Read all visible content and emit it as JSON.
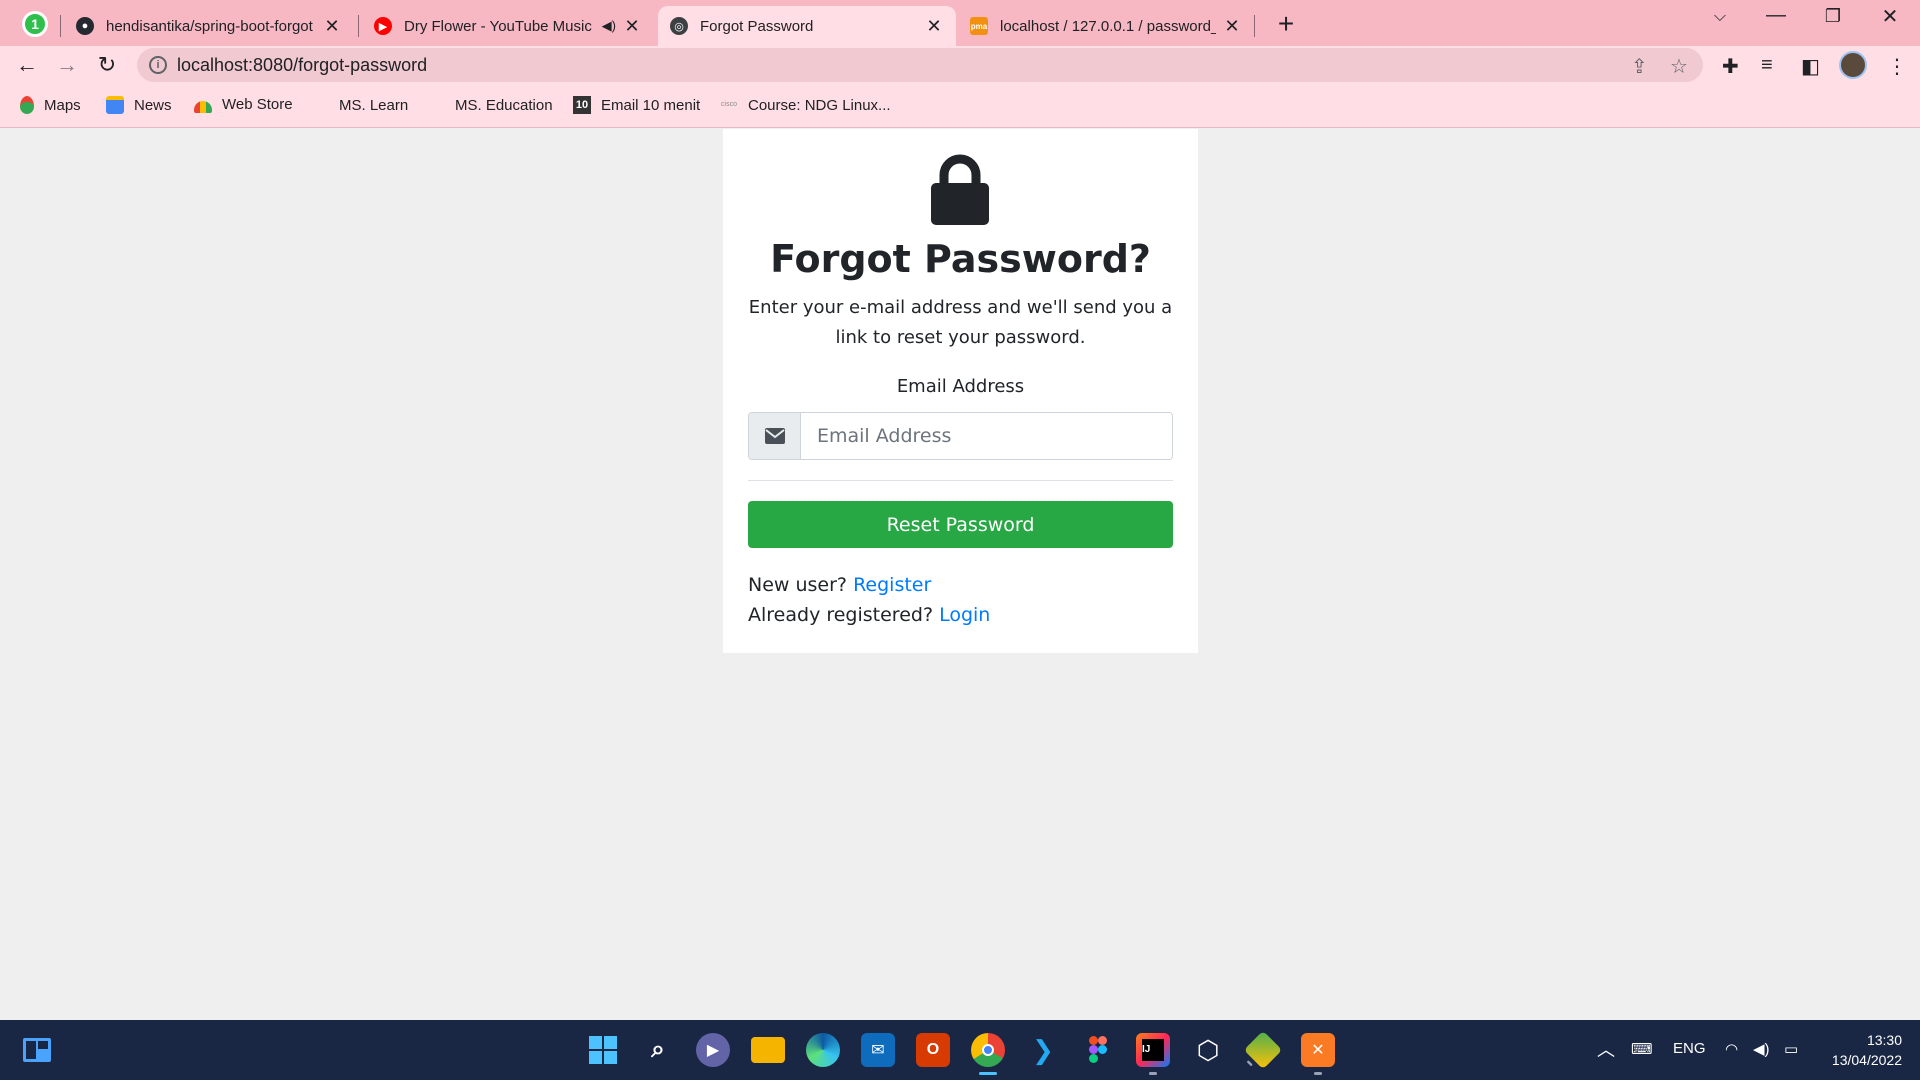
{
  "browser": {
    "tabs": [
      {
        "title": "hendisantika/spring-boot-forgot",
        "favicon": "github-icon"
      },
      {
        "title": "Dry Flower - YouTube Music",
        "favicon": "youtube-music-icon",
        "audio": "speaker-icon"
      },
      {
        "title": "Forgot Password",
        "favicon": "globe-icon",
        "active": true
      },
      {
        "title": "localhost / 127.0.0.1 / password_",
        "favicon": "phpmyadmin-icon"
      }
    ],
    "pinned_badge": "1",
    "url": "localhost:8080/forgot-password",
    "info_glyph": "i"
  },
  "bookmarks": [
    {
      "label": "Maps",
      "icon": "maps-pin-icon"
    },
    {
      "label": "News",
      "icon": "google-news-icon"
    },
    {
      "label": "Web Store",
      "icon": "web-store-icon"
    },
    {
      "label": "MS. Learn",
      "icon": "microsoft-icon"
    },
    {
      "label": "MS. Education",
      "icon": "microsoft-icon"
    },
    {
      "label": "Email 10 menit",
      "icon": "ten-icon",
      "icon_text": "10"
    },
    {
      "label": "Course: NDG Linux...",
      "icon": "cisco-icon",
      "icon_text": "cisco"
    }
  ],
  "page": {
    "title": "Forgot Password?",
    "description": "Enter your e-mail address and we'll send you a link to reset your password.",
    "email_label": "Email Address",
    "email_placeholder": "Email Address",
    "email_value": "",
    "submit_label": "Reset Password",
    "new_user_text": "New user?",
    "register_link": "Register",
    "registered_text": "Already registered?",
    "login_link": "Login"
  },
  "taskbar": {
    "apps": [
      "start-icon",
      "search-icon",
      "teams-chat-icon",
      "file-explorer-icon",
      "edge-icon",
      "mail-icon",
      "office-icon",
      "chrome-icon",
      "vscode-icon",
      "figma-icon",
      "intellij-icon",
      "virtualbox-icon",
      "git-icon",
      "xampp-icon"
    ],
    "lang": "ENG",
    "time": "13:30",
    "date": "13/04/2022"
  },
  "colors": {
    "tabstrip": "#f7b8c4",
    "toolbar": "#ffdfe5",
    "page_bg": "#efeff0",
    "button_green": "#28a745",
    "link_blue": "#007bff",
    "taskbar": "#1a2744"
  }
}
